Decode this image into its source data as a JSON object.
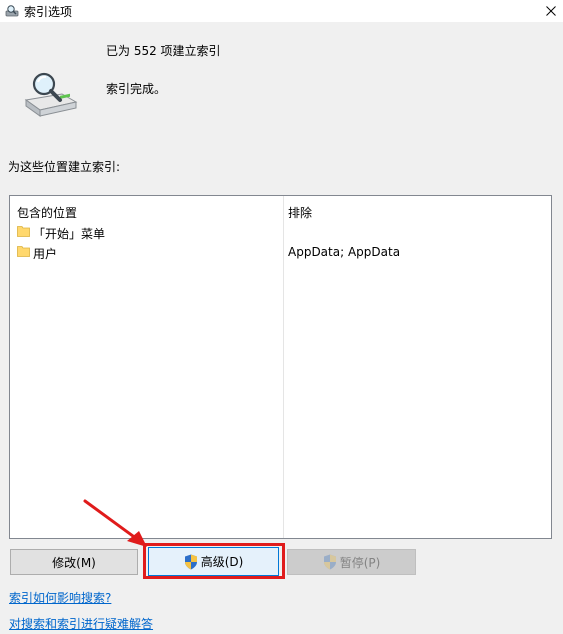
{
  "window": {
    "title": "索引选项",
    "icon": "indexing-options-icon",
    "close_icon": "close-icon"
  },
  "status": {
    "indexed_text": "已为 552 项建立索引",
    "complete_text": "索引完成。"
  },
  "locations": {
    "section_label": "为这些位置建立索引:",
    "col_included": "包含的位置",
    "col_excluded": "排除",
    "rows": [
      {
        "name": "「开始」菜单",
        "exclude": ""
      },
      {
        "name": "用户",
        "exclude": "AppData; AppData"
      }
    ]
  },
  "buttons": {
    "modify": "修改(M)",
    "advanced": "高级(D)",
    "pause": "暂停(P)"
  },
  "links": {
    "how_indexing": "索引如何影响搜索?",
    "troubleshoot": "对搜索和索引进行疑难解答"
  },
  "colors": {
    "annotation": "#e01b1b",
    "link": "#0066cc",
    "focus_border": "#0078d7"
  }
}
